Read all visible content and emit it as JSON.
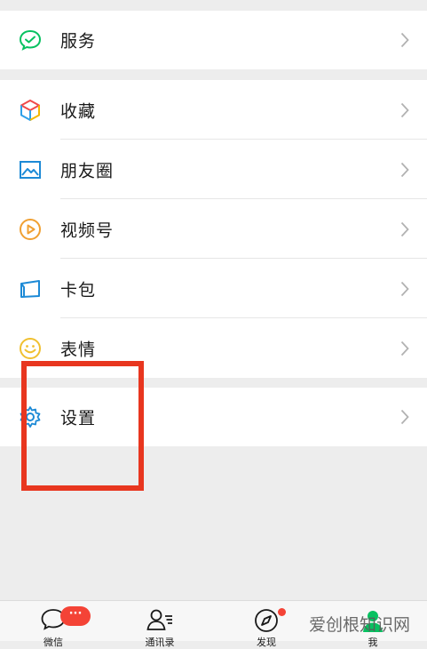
{
  "menu": {
    "services": {
      "label": "服务",
      "icon": "wechat-pay-icon",
      "color": "#07c160"
    },
    "favorites": {
      "label": "收藏",
      "icon": "cube-icon"
    },
    "moments": {
      "label": "朋友圈",
      "icon": "photo-icon",
      "color": "#1d8ad6"
    },
    "channels": {
      "label": "视频号",
      "icon": "play-circle-icon",
      "color": "#f0a032"
    },
    "cards": {
      "label": "卡包",
      "icon": "wallet-icon",
      "color": "#1d8ad6"
    },
    "stickers": {
      "label": "表情",
      "icon": "smile-icon",
      "color": "#f0c030"
    },
    "settings": {
      "label": "设置",
      "icon": "gear-icon",
      "color": "#1d8ad6"
    }
  },
  "tabbar": {
    "chats": {
      "label": "微信",
      "badge": "···"
    },
    "contacts": {
      "label": "通讯录"
    },
    "discover": {
      "label": "发现"
    },
    "me": {
      "label": "我"
    }
  },
  "watermark": "爱创根知识网",
  "colors": {
    "highlight": "#e8361f",
    "badge": "#f44336",
    "background": "#ededed"
  }
}
